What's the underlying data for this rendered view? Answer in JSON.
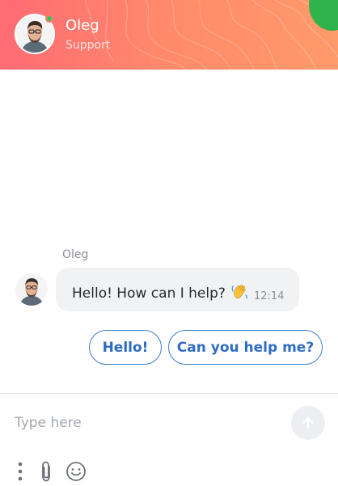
{
  "header": {
    "agent_name": "Oleg",
    "agent_role": "Support",
    "online_status_color": "#35c759",
    "accent_color": "#ff6b73"
  },
  "conversation": {
    "messages": [
      {
        "sender": "Oleg",
        "text": "Hello! How can I help?",
        "emoji": "waving-hand-icon",
        "time": "12:14"
      }
    ],
    "quick_replies": [
      {
        "label": "Hello!"
      },
      {
        "label": "Can you help me?"
      }
    ]
  },
  "composer": {
    "placeholder": "Type here",
    "value": "",
    "send_icon": "arrow-up-icon",
    "tools": [
      "more-vertical-icon",
      "paperclip-icon",
      "smile-icon"
    ]
  }
}
